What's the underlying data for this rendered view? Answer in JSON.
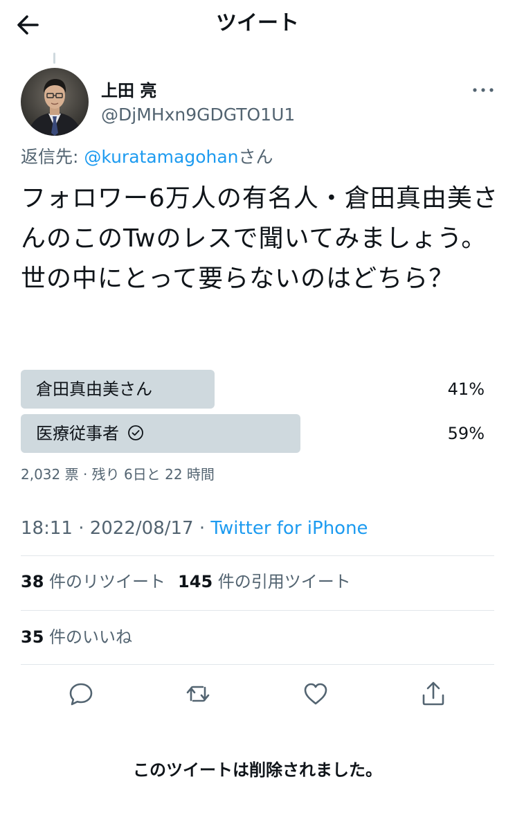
{
  "header": {
    "title": "ツイート"
  },
  "author": {
    "name": "上田 亮",
    "handle": "@DjMHxn9GDGTO1U1"
  },
  "reply": {
    "prefix": "返信先: ",
    "mention": "@kuratamagohan",
    "suffix": "さん"
  },
  "tweet": {
    "text": "フォロワー6万人の有名人・倉田真由美さんのこのTwのレスで聞いてみましょう。\n世の中にとって要らないのはどちら？"
  },
  "poll": {
    "options": [
      {
        "label": "倉田真由美さん",
        "percent_label": "41%",
        "percent": 41,
        "winner": false
      },
      {
        "label": "医療従事者",
        "percent_label": "59%",
        "percent": 59,
        "winner": true
      }
    ],
    "meta": "2,032 票 · 残り 6日と 22 時間"
  },
  "timestamp": {
    "time": "18:11 · 2022/08/17 · ",
    "source": "Twitter for iPhone"
  },
  "stats": {
    "retweets_count": "38",
    "retweets_label": "件のリツイート",
    "quotes_count": "145",
    "quotes_label": "件の引用ツイート",
    "likes_count": "35",
    "likes_label": "件のいいね"
  },
  "footer": {
    "deleted_notice": "このツイートは削除されました。"
  },
  "colors": {
    "accent": "#1d9bf0",
    "poll_fill": "#cfd9de",
    "secondary_text": "#536471",
    "text": "#0f1419"
  },
  "icons": {
    "back": "arrow-left-icon",
    "more": "more-horizontal-icon",
    "reply": "reply-icon",
    "retweet": "retweet-icon",
    "like": "heart-icon",
    "share": "share-icon",
    "check": "check-circle-icon"
  }
}
